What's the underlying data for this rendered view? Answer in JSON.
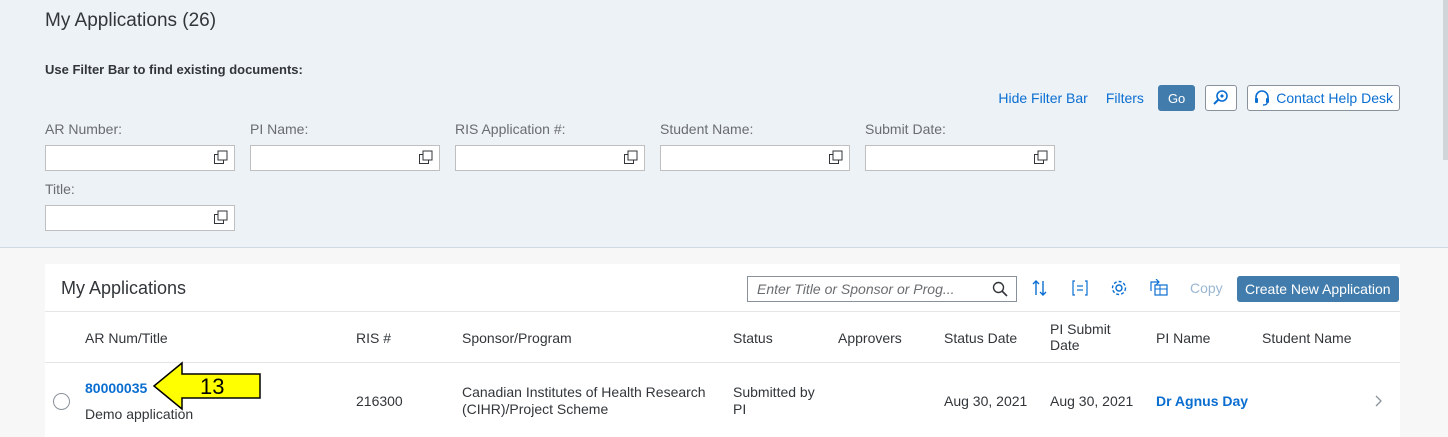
{
  "page": {
    "title": "My Applications (26)",
    "filter_hint": "Use Filter Bar to find existing documents:"
  },
  "filter_actions": {
    "hide": "Hide Filter Bar",
    "filters": "Filters",
    "go": "Go",
    "contact": "Contact Help Desk"
  },
  "filters": {
    "ar_number": "AR Number:",
    "pi_name": "PI Name:",
    "ris_application": "RIS Application #:",
    "student_name": "Student Name:",
    "submit_date": "Submit Date:",
    "title": "Title:"
  },
  "table": {
    "title": "My Applications",
    "search_placeholder": "Enter Title or Sponsor or Prog...",
    "copy": "Copy",
    "create": "Create New Application",
    "columns": {
      "ar": "AR Num/Title",
      "ris": "RIS #",
      "sponsor": "Sponsor/Program",
      "status": "Status",
      "approvers": "Approvers",
      "status_date": "Status Date",
      "pi_submit": "PI Submit Date",
      "pi_name": "PI Name",
      "student": "Student Name"
    },
    "rows": [
      {
        "ar": "80000035",
        "title": "Demo application",
        "ris": "216300",
        "sponsor": "Canadian Institutes of Health Research (CIHR)/Project Scheme",
        "status": "Submitted by PI",
        "approvers": "",
        "status_date": "Aug 30, 2021",
        "pi_submit": "Aug 30, 2021",
        "pi_name": "Dr Agnus Day",
        "student": ""
      }
    ]
  },
  "callout": {
    "label": "13",
    "color": "#ffff00"
  },
  "colors": {
    "accent": "#0a6ed1",
    "button": "#427cac",
    "filter_bg": "#edf2f7"
  }
}
